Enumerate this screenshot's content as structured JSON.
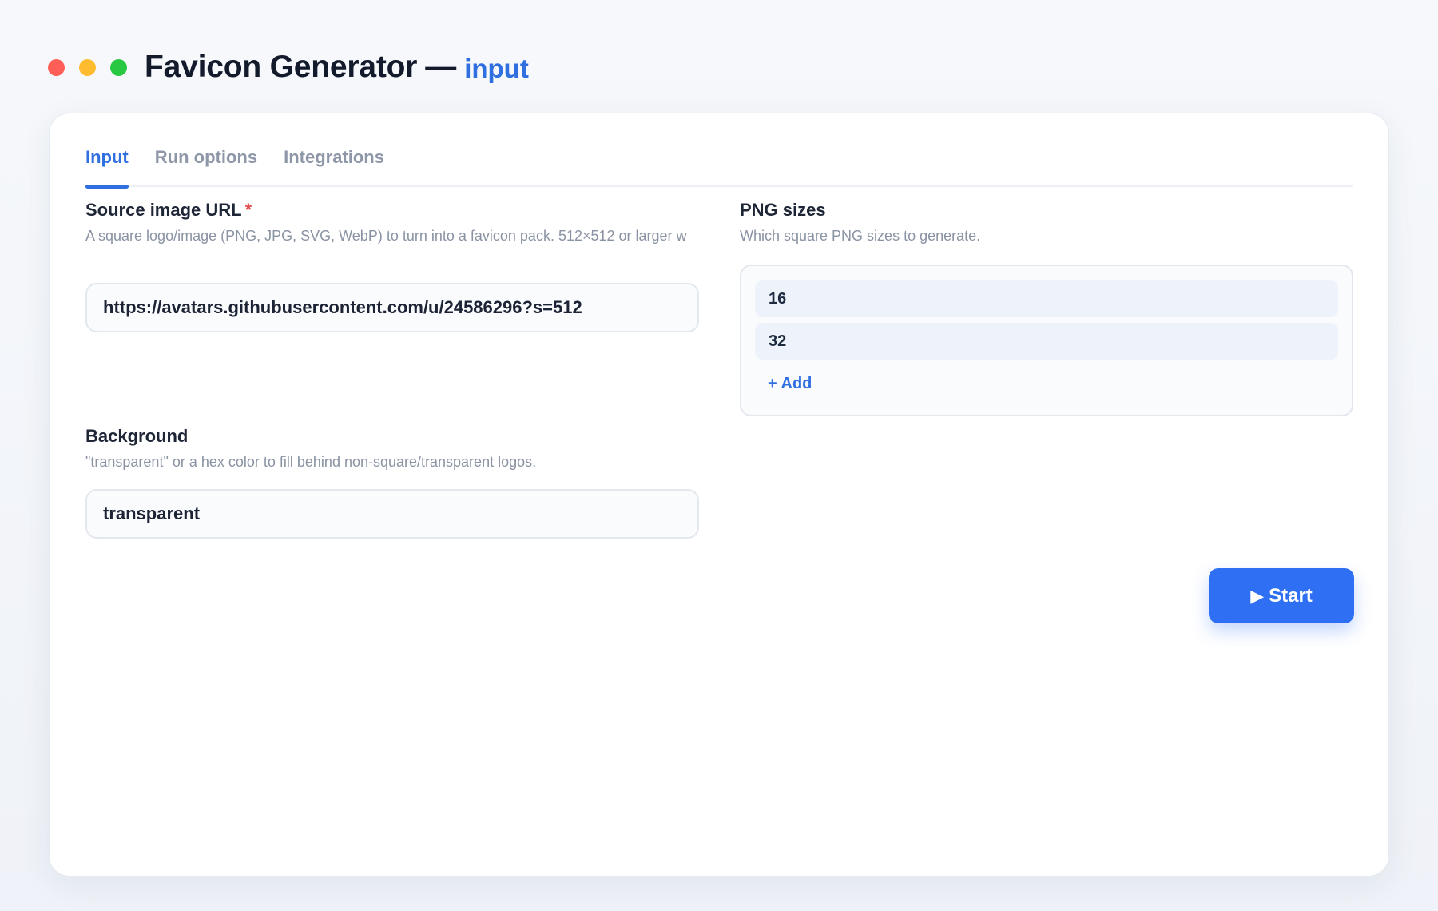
{
  "window": {
    "title": "Favicon Generator",
    "separator": "—",
    "subtitle": "input",
    "controls": [
      "close",
      "minimize",
      "maximize"
    ]
  },
  "tabs": [
    {
      "label": "Input",
      "active": true
    },
    {
      "label": "Run options",
      "active": false
    },
    {
      "label": "Integrations",
      "active": false
    }
  ],
  "source_url": {
    "label": "Source image URL",
    "required_mark": "*",
    "description": "A square logo/image (PNG, JPG, SVG, WebP) to turn into a favicon pack. 512×512 or larger w",
    "value": "https://avatars.githubusercontent.com/u/24586296?s=512"
  },
  "png_sizes": {
    "label": "PNG sizes",
    "description": "Which square PNG sizes to generate.",
    "items": [
      "16",
      "32"
    ],
    "add_label": "+ Add"
  },
  "background": {
    "label": "Background",
    "description": "\"transparent\" or a hex color to fill behind non-square/transparent logos.",
    "value": "transparent"
  },
  "actions": {
    "start_icon": "play-icon",
    "start_label": "Start"
  },
  "colors": {
    "accent": "#2f6fe0",
    "button": "#2f6ff3",
    "required": "#e44d4d"
  }
}
